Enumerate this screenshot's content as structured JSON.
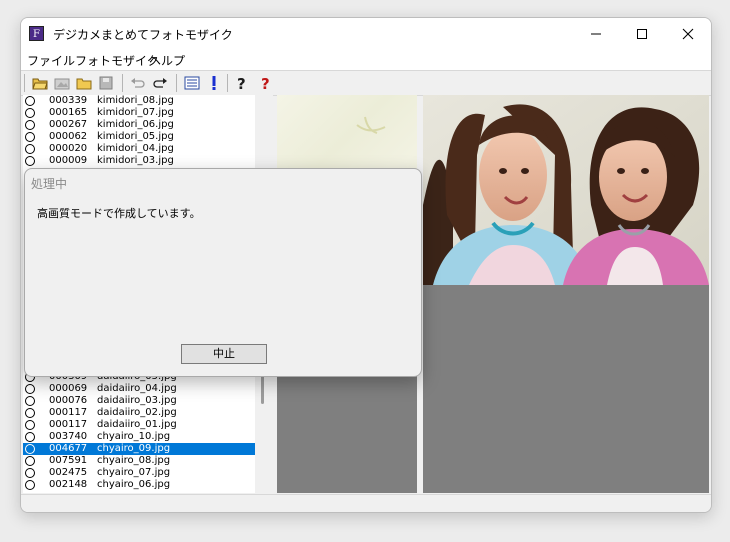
{
  "window": {
    "title": "デジカメまとめてフォトモザイク",
    "app_icon_letter": "F",
    "controls": {
      "minimize": "minimize",
      "maximize": "maximize",
      "close": "close"
    }
  },
  "menu": [
    {
      "label": "ファイル"
    },
    {
      "label": "フォトモザイク"
    },
    {
      "label": "ヘルプ"
    }
  ],
  "toolbar": {
    "icons": [
      "open-folder-icon",
      "image-icon",
      "folder-icon",
      "save-icon",
      "undo-icon",
      "redo-icon",
      "list-icon",
      "exclamation-icon",
      "help-icon",
      "context-help-icon"
    ]
  },
  "file_list": {
    "rows_top": [
      {
        "count": "000339",
        "name": "kimidori_08.jpg"
      },
      {
        "count": "000165",
        "name": "kimidori_07.jpg"
      },
      {
        "count": "000267",
        "name": "kimidori_06.jpg"
      },
      {
        "count": "000062",
        "name": "kimidori_05.jpg"
      },
      {
        "count": "000020",
        "name": "kimidori_04.jpg"
      },
      {
        "count": "000009",
        "name": "kimidori_03.jpg"
      }
    ],
    "rows_bottom": [
      {
        "count": "000309",
        "name": "daidaiiro_05.jpg"
      },
      {
        "count": "000069",
        "name": "daidaiiro_04.jpg"
      },
      {
        "count": "000076",
        "name": "daidaiiro_03.jpg"
      },
      {
        "count": "000117",
        "name": "daidaiiro_02.jpg"
      },
      {
        "count": "000117",
        "name": "daidaiiro_01.jpg"
      },
      {
        "count": "003740",
        "name": "chyairo_10.jpg"
      },
      {
        "count": "004677",
        "name": "chyairo_09.jpg",
        "selected": true
      },
      {
        "count": "007591",
        "name": "chyairo_08.jpg"
      },
      {
        "count": "002475",
        "name": "chyairo_07.jpg"
      },
      {
        "count": "002148",
        "name": "chyairo_06.jpg"
      }
    ]
  },
  "dialog": {
    "title": "処理中",
    "message": "高画質モードで作成しています。",
    "cancel_label": "中止"
  },
  "colors": {
    "selection": "#0078d7",
    "panel_gray": "#7f7f7f"
  }
}
